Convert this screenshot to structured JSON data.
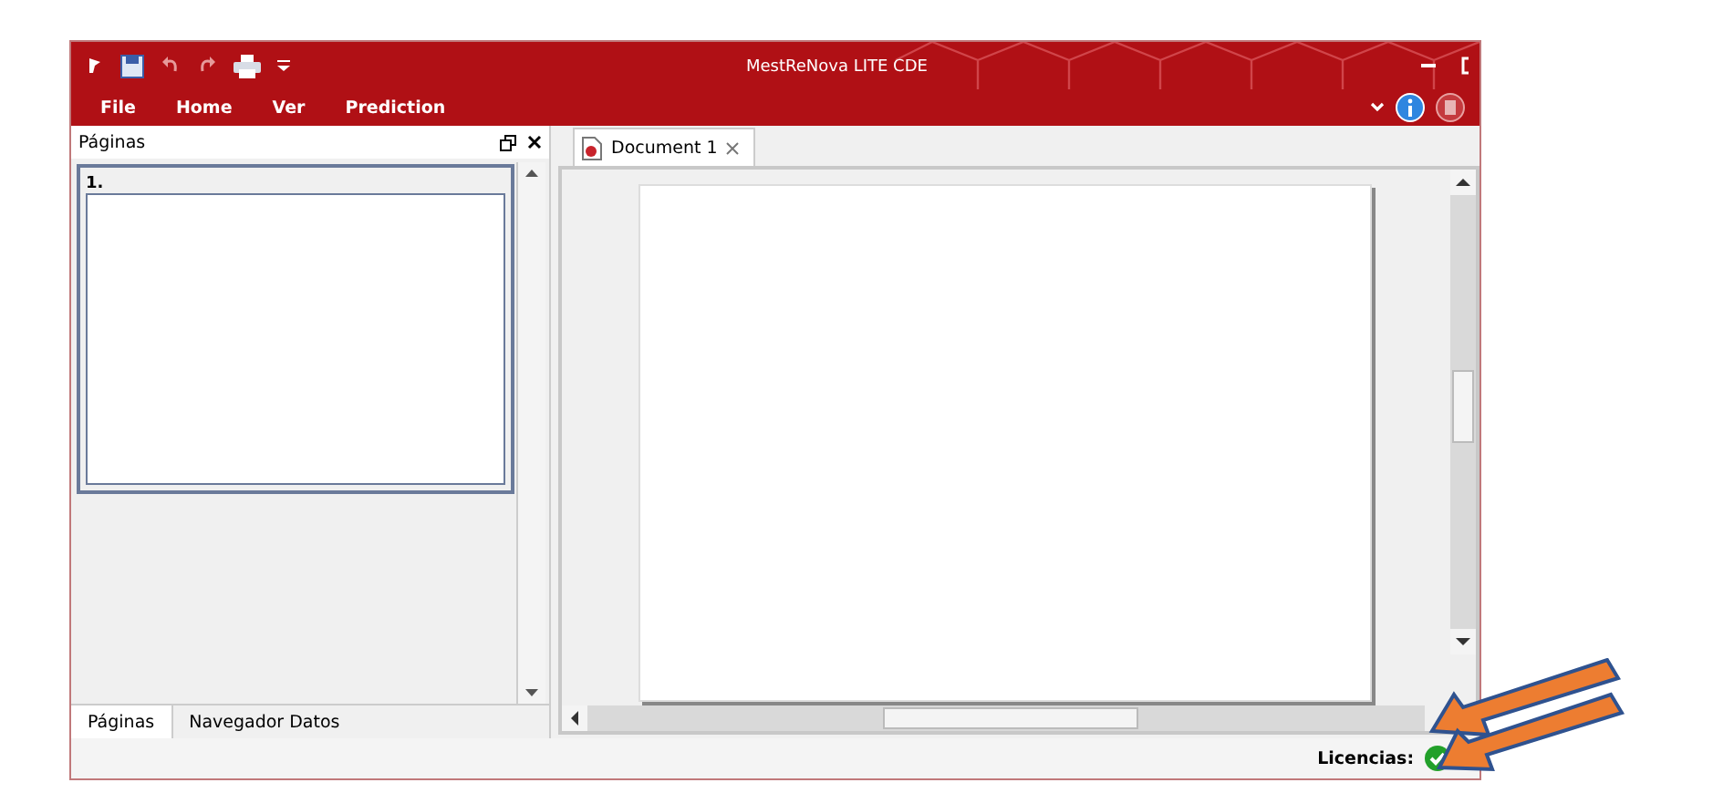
{
  "window": {
    "title": "MestReNova LITE CDE"
  },
  "menu": [
    {
      "label": "File",
      "selected": false
    },
    {
      "label": "Home",
      "selected": false
    },
    {
      "label": "Ver",
      "selected": false
    },
    {
      "label": "Prediction",
      "selected": false
    }
  ],
  "pages_panel": {
    "title": "Páginas",
    "pages": [
      {
        "label": "1.",
        "selected": true
      }
    ],
    "tabs": [
      {
        "label": "Páginas",
        "selected": true
      },
      {
        "label": "Navegador Datos",
        "selected": false
      }
    ]
  },
  "document_tabs": [
    {
      "label": "Document 1",
      "selected": true
    }
  ],
  "status_bar": {
    "license_label": "Licencias:",
    "license_ok": true
  }
}
